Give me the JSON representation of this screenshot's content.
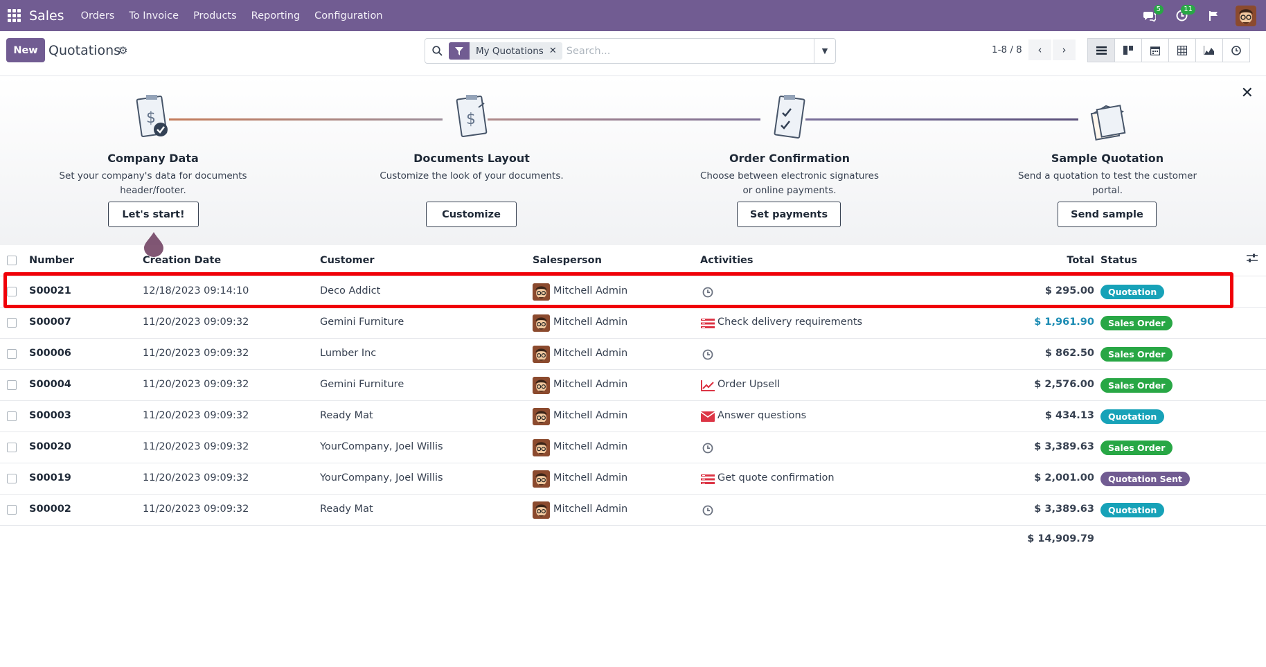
{
  "nav": {
    "brand": "Sales",
    "menu": [
      "Orders",
      "To Invoice",
      "Products",
      "Reporting",
      "Configuration"
    ],
    "messages_count": "5",
    "activities_count": "11"
  },
  "control": {
    "new_label": "New",
    "title": "Quotations",
    "facet_label": "My Quotations",
    "search_placeholder": "Search...",
    "pager": "1-8 / 8"
  },
  "onboarding": {
    "steps": [
      {
        "title": "Company Data",
        "desc1": "Set your company's data for documents",
        "desc2": "header/footer.",
        "button": "Let's start!"
      },
      {
        "title": "Documents Layout",
        "desc1": "Customize the look of your documents.",
        "desc2": "",
        "button": "Customize"
      },
      {
        "title": "Order Confirmation",
        "desc1": "Choose between electronic signatures",
        "desc2": "or online payments.",
        "button": "Set payments"
      },
      {
        "title": "Sample Quotation",
        "desc1": "Send a quotation to test the customer",
        "desc2": "portal.",
        "button": "Send sample"
      }
    ]
  },
  "table": {
    "headers": {
      "number": "Number",
      "date": "Creation Date",
      "customer": "Customer",
      "salesperson": "Salesperson",
      "activities": "Activities",
      "total": "Total",
      "status": "Status"
    },
    "rows": [
      {
        "number": "S00021",
        "date": "12/18/2023 09:14:10",
        "customer": "Deco Addict",
        "salesperson": "Mitchell Admin",
        "activity_icon": "clock-icon",
        "activity": "",
        "total": "$ 295.00",
        "status": "Quotation"
      },
      {
        "number": "S00007",
        "date": "11/20/2023 09:09:32",
        "customer": "Gemini Furniture",
        "salesperson": "Mitchell Admin",
        "activity_icon": "tasks-icon",
        "activity": "Check delivery requirements",
        "total": "$ 1,961.90",
        "status": "Sales Order"
      },
      {
        "number": "S00006",
        "date": "11/20/2023 09:09:32",
        "customer": "Lumber Inc",
        "salesperson": "Mitchell Admin",
        "activity_icon": "clock-icon",
        "activity": "",
        "total": "$ 862.50",
        "status": "Sales Order"
      },
      {
        "number": "S00004",
        "date": "11/20/2023 09:09:32",
        "customer": "Gemini Furniture",
        "salesperson": "Mitchell Admin",
        "activity_icon": "chart-line-icon",
        "activity": "Order Upsell",
        "total": "$ 2,576.00",
        "status": "Sales Order"
      },
      {
        "number": "S00003",
        "date": "11/20/2023 09:09:32",
        "customer": "Ready Mat",
        "salesperson": "Mitchell Admin",
        "activity_icon": "envelope-icon",
        "activity": "Answer questions",
        "total": "$ 434.13",
        "status": "Quotation"
      },
      {
        "number": "S00020",
        "date": "11/20/2023 09:09:32",
        "customer": "YourCompany, Joel Willis",
        "salesperson": "Mitchell Admin",
        "activity_icon": "clock-icon",
        "activity": "",
        "total": "$ 3,389.63",
        "status": "Sales Order"
      },
      {
        "number": "S00019",
        "date": "11/20/2023 09:09:32",
        "customer": "YourCompany, Joel Willis",
        "salesperson": "Mitchell Admin",
        "activity_icon": "tasks-icon",
        "activity": "Get quote confirmation",
        "total": "$ 2,001.00",
        "status": "Quotation Sent"
      },
      {
        "number": "S00002",
        "date": "11/20/2023 09:09:32",
        "customer": "Ready Mat",
        "salesperson": "Mitchell Admin",
        "activity_icon": "clock-icon",
        "activity": "",
        "total": "$ 3,389.63",
        "status": "Quotation"
      }
    ],
    "sum_total": "$ 14,909.79"
  },
  "colors": {
    "brand": "#715c92",
    "quotation": "#17a2b8",
    "sales_order": "#28a745",
    "highlight": "#f00008"
  }
}
